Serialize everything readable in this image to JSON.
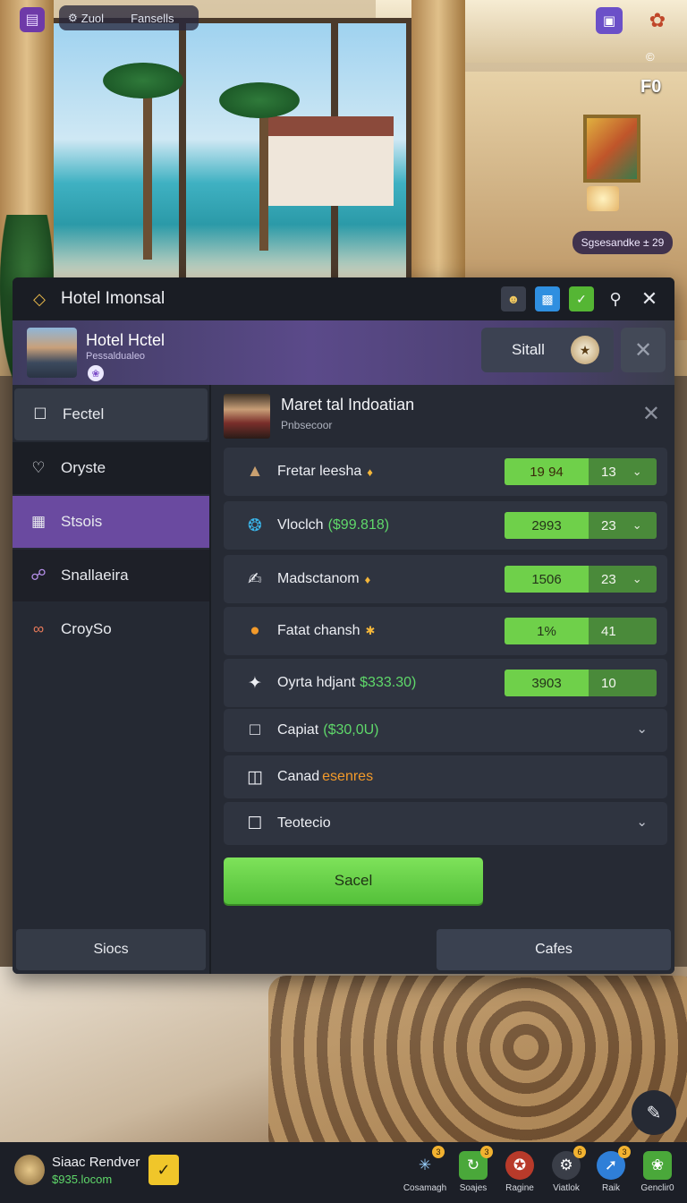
{
  "topbar": {
    "left_pill_a": "Zuol",
    "left_pill_b": "Fansells",
    "corner_small": "©",
    "fo_label": "F0",
    "room_chip": "Sgsesandke ± 29"
  },
  "window": {
    "title": "Hotel Imonsal"
  },
  "hotel": {
    "name": "Hotel Hctel",
    "subtitle": "Pessaldualeo",
    "stall_label": "Sitall"
  },
  "sidebar": {
    "items": [
      {
        "label": "Fectel",
        "icon": "lock-icon"
      },
      {
        "label": "Oryste",
        "icon": "heart-icon"
      },
      {
        "label": "Stsois",
        "icon": "grid-icon"
      },
      {
        "label": "Snallaeira",
        "icon": "link-icon"
      },
      {
        "label": "CroySo",
        "icon": "infinity-icon"
      }
    ],
    "bottom_button": "Siocs"
  },
  "profile": {
    "name": "Maret tal Indoatian",
    "subtitle": "Pnbsecoor"
  },
  "rows": [
    {
      "label": "Fretar leesha",
      "extra": "",
      "value_a": "19 94",
      "value_b": "13",
      "icon": "hat-icon",
      "chevron": true
    },
    {
      "label": "Vloclch",
      "extra": "($99.818)",
      "value_a": "2993",
      "value_b": "23",
      "icon": "swirl-icon",
      "chevron": true
    },
    {
      "label": "Madsctanom",
      "extra": "",
      "value_a": "1506",
      "value_b": "23",
      "icon": "thumb-icon",
      "chevron": true
    },
    {
      "label": "Fatat chansh",
      "extra": "",
      "value_a": "1%",
      "value_b": "41",
      "icon": "orb-icon",
      "chevron": false
    },
    {
      "label": "Oyrta hdjant",
      "extra": "$333.30)",
      "value_a": "3903",
      "value_b": "10",
      "icon": "rocket-icon",
      "chevron": false
    },
    {
      "label": "Capiat",
      "extra": "($30,0U)",
      "icon": "file-icon",
      "chevron": true
    },
    {
      "label": "Canad",
      "extra": "esenres",
      "icon": "slash-box-icon",
      "chevron": false
    },
    {
      "label": "Teotecio",
      "extra": "",
      "icon": "checkbox-icon",
      "chevron": true
    }
  ],
  "actions": {
    "save": "Sacel",
    "cafes": "Cafes"
  },
  "user": {
    "name": "Siaac Rendver",
    "balance": "$935.locom"
  },
  "dock": [
    {
      "label": "Cosamagh",
      "badge": "3",
      "color": "#2a2e38",
      "icon": "network-icon"
    },
    {
      "label": "Soajes",
      "badge": "3",
      "color": "#4aa83a",
      "icon": "refresh-icon"
    },
    {
      "label": "Ragine",
      "badge": "",
      "color": "#b83a2a",
      "icon": "shield-icon"
    },
    {
      "label": "Viatlok",
      "badge": "6",
      "color": "#3a3e48",
      "icon": "gear-icon"
    },
    {
      "label": "Raik",
      "badge": "3",
      "color": "#2f7fd8",
      "icon": "arrow-icon"
    },
    {
      "label": "Genclir0",
      "badge": "",
      "color": "#4aa83a",
      "icon": "leaf-icon"
    }
  ],
  "colors": {
    "accent_purple": "#6a4aa0",
    "accent_green": "#6fd04a",
    "panel_bg": "#232733"
  }
}
